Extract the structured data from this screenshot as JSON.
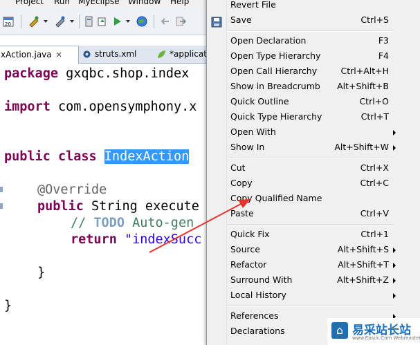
{
  "menubar": {
    "items": [
      "Project",
      "Run",
      "MyEclipse",
      "Window",
      "Help"
    ]
  },
  "tabs": [
    {
      "label": "xAction.java",
      "close": "✕"
    },
    {
      "label": "struts.xml"
    },
    {
      "label": "*applicat"
    }
  ],
  "editor": {
    "line1_kw": "package",
    "line1_rest": " gxqbc.shop.index",
    "line2_kw": "import",
    "line2_rest": " com.opensymphony.x",
    "line3_kw": "public class",
    "line3_sel": "IndexAction",
    "line4_ann": "@Override",
    "line5_kw": "public",
    "line5_rest": " String execute",
    "line6_cm": "// ",
    "line6_todo": "TODO",
    "line6_rest": " Auto-gen",
    "line7_kw": "return",
    "line7_str": " \"indexSucc",
    "line8": "}",
    "line9": "}"
  },
  "context_menu": {
    "items": [
      {
        "label": "Revert File",
        "shortcut": ""
      },
      {
        "label": "Save",
        "shortcut": "Ctrl+S"
      },
      {
        "label": "Open Declaration",
        "shortcut": "F3"
      },
      {
        "label": "Open Type Hierarchy",
        "shortcut": "F4"
      },
      {
        "label": "Open Call Hierarchy",
        "shortcut": "Ctrl+Alt+H"
      },
      {
        "label": "Show in Breadcrumb",
        "shortcut": "Alt+Shift+B"
      },
      {
        "label": "Quick Outline",
        "shortcut": "Ctrl+O"
      },
      {
        "label": "Quick Type Hierarchy",
        "shortcut": "Ctrl+T"
      },
      {
        "label": "Open With",
        "shortcut": ""
      },
      {
        "label": "Show In",
        "shortcut": "Alt+Shift+W"
      },
      {
        "label": "Cut",
        "shortcut": "Ctrl+X"
      },
      {
        "label": "Copy",
        "shortcut": "Ctrl+C"
      },
      {
        "label": "Copy Qualified Name",
        "shortcut": ""
      },
      {
        "label": "Paste",
        "shortcut": "Ctrl+V"
      },
      {
        "label": "Quick Fix",
        "shortcut": "Ctrl+1"
      },
      {
        "label": "Source",
        "shortcut": "Alt+Shift+S"
      },
      {
        "label": "Refactor",
        "shortcut": "Alt+Shift+T"
      },
      {
        "label": "Surround With",
        "shortcut": "Alt+Shift+Z"
      },
      {
        "label": "Local History",
        "shortcut": ""
      },
      {
        "label": "References",
        "shortcut": ""
      },
      {
        "label": "Declarations",
        "shortcut": ""
      }
    ]
  },
  "watermark": {
    "title": "易采站长站",
    "subtitle": "www.Easck.Com Webmaster"
  },
  "colors": {
    "keyword": "#7f0055",
    "string": "#2a00ff",
    "comment": "#3f7f5f",
    "selection": "#3399ff",
    "arrow": "#e8322c"
  }
}
